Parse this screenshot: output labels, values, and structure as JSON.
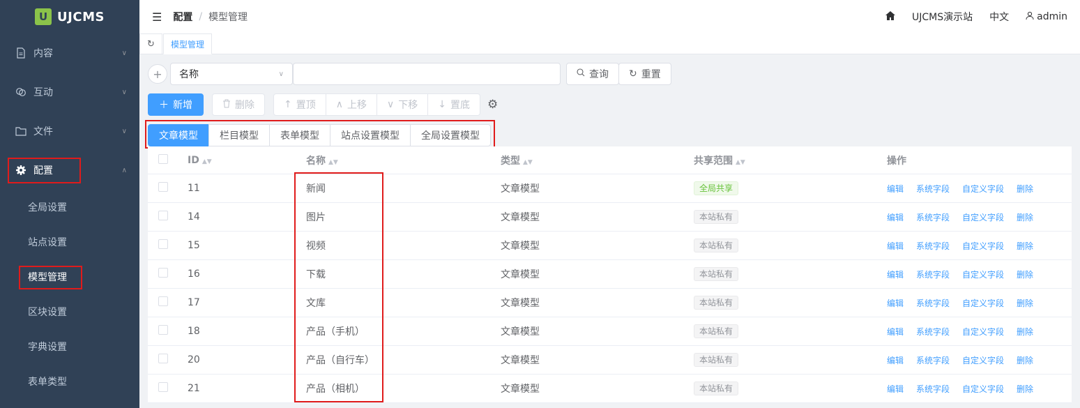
{
  "brand": {
    "logo_mark": "U",
    "name": "UJCMS"
  },
  "sidebar": {
    "menus": [
      {
        "label": "内容",
        "icon": "document-icon"
      },
      {
        "label": "互动",
        "icon": "chat-icon"
      },
      {
        "label": "文件",
        "icon": "folder-icon"
      },
      {
        "label": "配置",
        "icon": "gear-icon"
      }
    ],
    "submenu": [
      "全局设置",
      "站点设置",
      "模型管理",
      "区块设置",
      "字典设置",
      "表单类型"
    ]
  },
  "header": {
    "breadcrumb": [
      "配置",
      "模型管理"
    ],
    "site": "UJCMS演示站",
    "language": "中文",
    "user": "admin"
  },
  "tagsview": {
    "current": "模型管理"
  },
  "search": {
    "field_select": "名称",
    "input_value": "",
    "query_label": "查询",
    "reset_label": "重置"
  },
  "toolbar": {
    "add_label": "新增",
    "delete_label": "删除",
    "top_label": "置顶",
    "up_label": "上移",
    "down_label": "下移",
    "bottom_label": "置底"
  },
  "tabs": [
    "文章模型",
    "栏目模型",
    "表单模型",
    "站点设置模型",
    "全局设置模型"
  ],
  "table": {
    "headers": {
      "id": "ID",
      "name": "名称",
      "type": "类型",
      "share": "共享范围",
      "ops": "操作"
    },
    "rows": [
      {
        "id": "11",
        "name": "新闻",
        "type": "文章模型",
        "share": "全局共享"
      },
      {
        "id": "14",
        "name": "图片",
        "type": "文章模型",
        "share": "本站私有"
      },
      {
        "id": "15",
        "name": "视频",
        "type": "文章模型",
        "share": "本站私有"
      },
      {
        "id": "16",
        "name": "下载",
        "type": "文章模型",
        "share": "本站私有"
      },
      {
        "id": "17",
        "name": "文库",
        "type": "文章模型",
        "share": "本站私有"
      },
      {
        "id": "18",
        "name": "产品（手机）",
        "type": "文章模型",
        "share": "本站私有"
      },
      {
        "id": "20",
        "name": "产品（自行车）",
        "type": "文章模型",
        "share": "本站私有"
      },
      {
        "id": "21",
        "name": "产品（相机）",
        "type": "文章模型",
        "share": "本站私有"
      }
    ],
    "ops": [
      "编辑",
      "系统字段",
      "自定义字段",
      "删除"
    ]
  },
  "colors": {
    "primary": "#409eff",
    "sidebar": "#304156",
    "highlight_box": "#e01b1b",
    "success": "#67c23a"
  }
}
